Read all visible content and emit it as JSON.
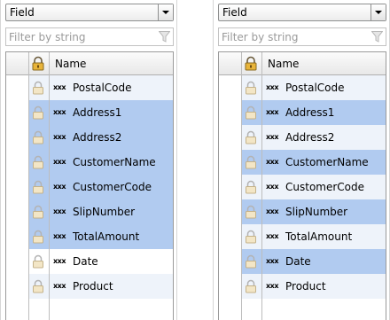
{
  "colors": {
    "selected": "#b1cbf0",
    "alt": "#eef3fa",
    "normal": "#ffffff"
  },
  "panels": [
    {
      "combo": {
        "value": "Field"
      },
      "filter": {
        "placeholder": "Filter by string",
        "value": ""
      },
      "header": {
        "name": "Name"
      },
      "rows": [
        {
          "label": "PostalCode",
          "icon": "xxx",
          "state": "alt"
        },
        {
          "label": "Address1",
          "icon": "xxx",
          "state": "selected"
        },
        {
          "label": "Address2",
          "icon": "xxx",
          "state": "selected"
        },
        {
          "label": "CustomerName",
          "icon": "xxx",
          "state": "selected"
        },
        {
          "label": "CustomerCode",
          "icon": "xxx",
          "state": "selected"
        },
        {
          "label": "SlipNumber",
          "icon": "xxx",
          "state": "selected"
        },
        {
          "label": "TotalAmount",
          "icon": "xxx",
          "state": "selected"
        },
        {
          "label": "Date",
          "icon": "xxx",
          "state": "normal"
        },
        {
          "label": "Product",
          "icon": "xxx",
          "state": "alt"
        }
      ]
    },
    {
      "combo": {
        "value": "Field"
      },
      "filter": {
        "placeholder": "Filter by string",
        "value": ""
      },
      "header": {
        "name": "Name"
      },
      "rows": [
        {
          "label": "PostalCode",
          "icon": "xxx",
          "state": "alt"
        },
        {
          "label": "Address1",
          "icon": "xxx",
          "state": "selected"
        },
        {
          "label": "Address2",
          "icon": "xxx",
          "state": "alt"
        },
        {
          "label": "CustomerName",
          "icon": "xxx",
          "state": "selected"
        },
        {
          "label": "CustomerCode",
          "icon": "xxx",
          "state": "alt"
        },
        {
          "label": "SlipNumber",
          "icon": "xxx",
          "state": "selected"
        },
        {
          "label": "TotalAmount",
          "icon": "xxx",
          "state": "alt"
        },
        {
          "label": "Date",
          "icon": "xxx",
          "state": "selected"
        },
        {
          "label": "Product",
          "icon": "xxx",
          "state": "alt"
        }
      ]
    }
  ]
}
